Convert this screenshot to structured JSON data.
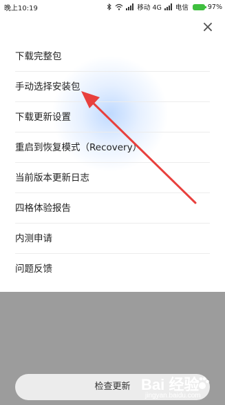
{
  "status_bar": {
    "time": "晚上10:19",
    "carrier1": "移动 4G",
    "carrier2": "电信",
    "battery": "97%"
  },
  "menu_items": [
    {
      "label": "下载完整包"
    },
    {
      "label": "手动选择安装包"
    },
    {
      "label": "下载更新设置"
    },
    {
      "label": "重启到恢复模式（Recovery）"
    },
    {
      "label": "当前版本更新日志"
    },
    {
      "label": "四格体验报告"
    },
    {
      "label": "内测申请"
    },
    {
      "label": "问题反馈"
    }
  ],
  "bottom_button": {
    "label": "检查更新"
  },
  "watermark": {
    "logo": "Bai 经验",
    "url": "jingyan.baidu.com"
  },
  "icons": [
    "close-icon",
    "bluetooth-icon",
    "wifi-icon",
    "signal-icon",
    "battery-icon",
    "paw-icon"
  ],
  "colors": {
    "annotation_arrow": "#e8403d",
    "battery": "#3fbf3f",
    "overlay": "#9c9c9c"
  }
}
